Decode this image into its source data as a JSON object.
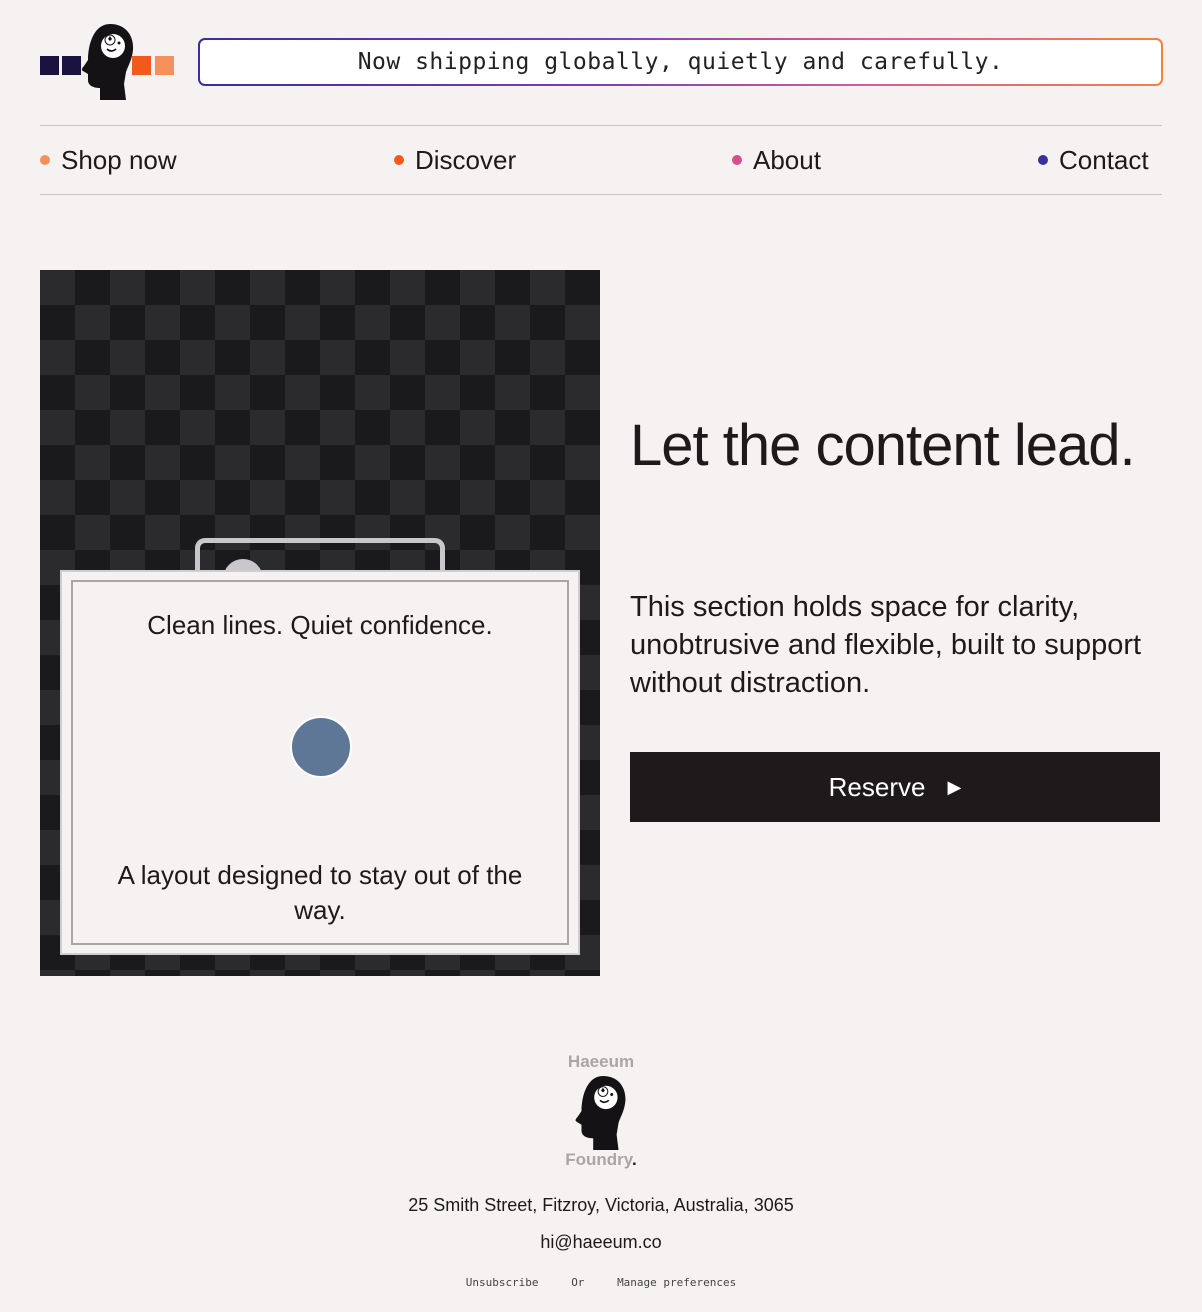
{
  "header": {
    "logo_name": "haeeum-head-logo",
    "logo_squares": [
      "#1a1340",
      "#1a1340",
      "#f25a1c",
      "#f6905a"
    ],
    "banner_text": "Now shipping globally, quietly and carefully.",
    "banner_gradient": [
      "#3b2e9e",
      "#7a3db4",
      "#d85c9a",
      "#f1833f"
    ]
  },
  "nav": {
    "items": [
      {
        "label": "Shop now",
        "dot_color": "#f6905a"
      },
      {
        "label": "Discover",
        "dot_color": "#f25a1c"
      },
      {
        "label": "About",
        "dot_color": "#d4508f"
      },
      {
        "label": "Contact",
        "dot_color": "#3b2e9e"
      }
    ]
  },
  "hero": {
    "card_title": "Clean lines. Quiet confidence.",
    "card_caption": "A layout designed to stay out of the way.",
    "card_dot_color": "#5e7797",
    "heading": "Let the content lead.",
    "body": "This section holds space for clarity, unobtrusive and flexible, built to support without distraction.",
    "button_label": "Reserve",
    "button_icon": "play-arrow-icon"
  },
  "footer": {
    "logo_word_top": "Haeeum",
    "logo_word_bottom": "Foundry",
    "logo_word_bottom_dot": ".",
    "address": "25 Smith Street, Fitzroy, Victoria, Australia, 3065",
    "email": "hi@haeeum.co",
    "unsubscribe": "Unsubscribe",
    "or": "Or",
    "manage": "Manage preferences"
  }
}
